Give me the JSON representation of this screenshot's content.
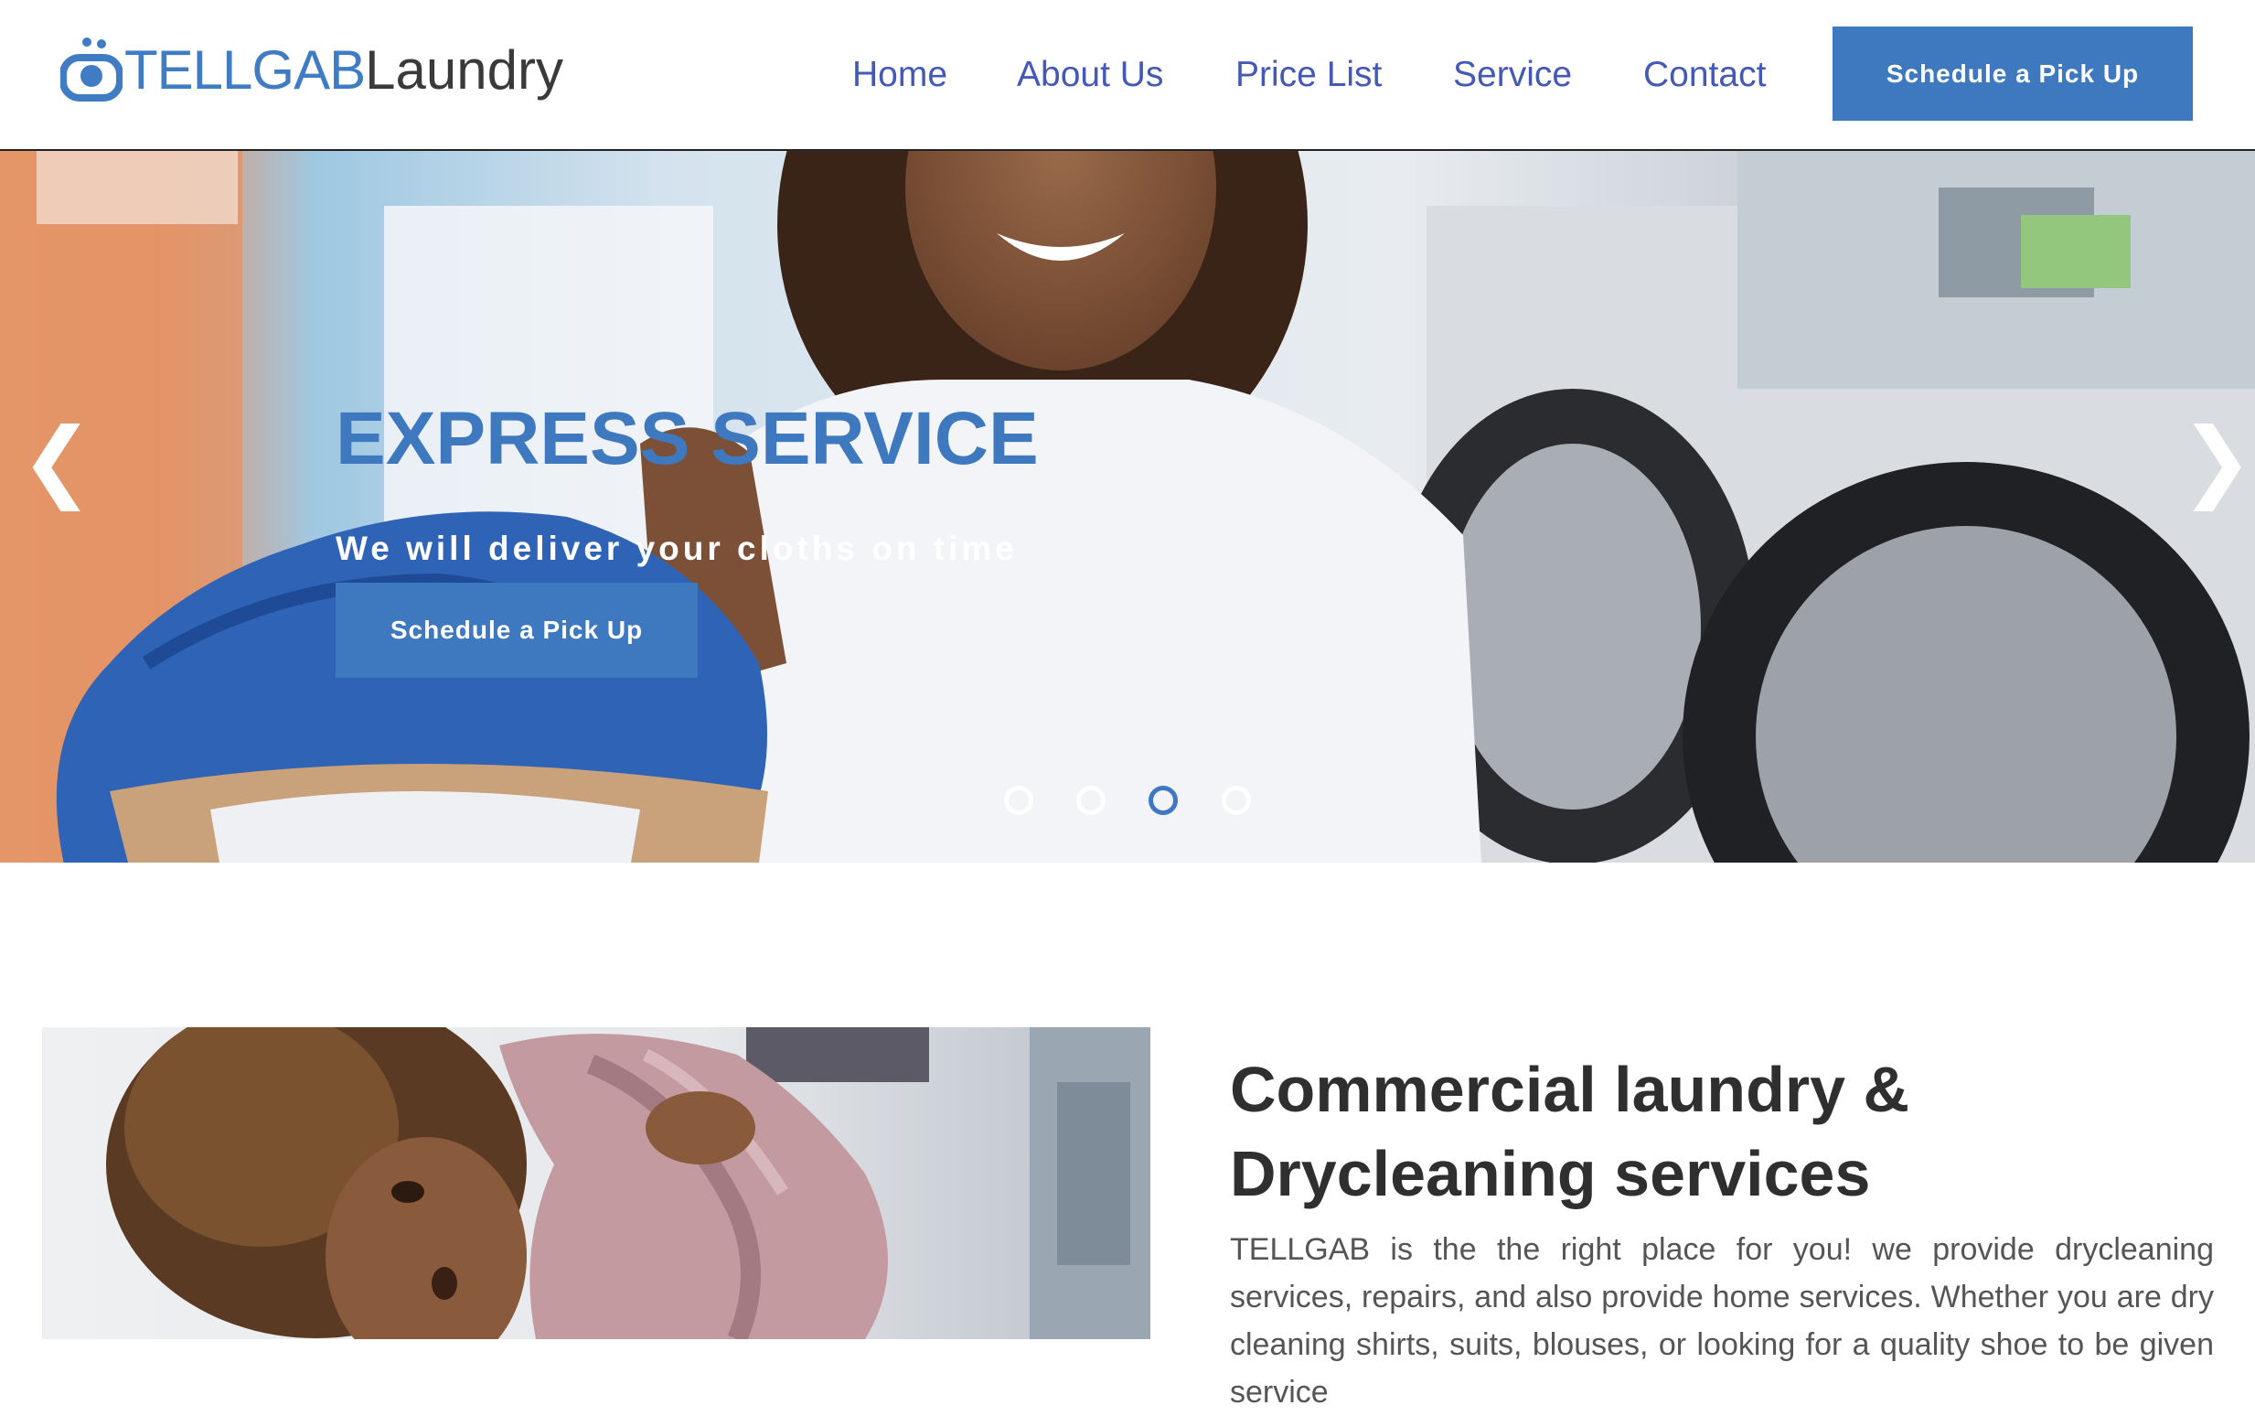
{
  "brand": {
    "name": "TELLGAB",
    "suffix": "Laundry",
    "icon": "washing-machine-logo-icon",
    "colors": {
      "accent": "#3e79c0",
      "nav": "#4458b6",
      "text": "#2f2f2f"
    }
  },
  "nav": {
    "items": [
      {
        "label": "Home"
      },
      {
        "label": "About Us"
      },
      {
        "label": "Price List"
      },
      {
        "label": "Service"
      },
      {
        "label": "Contact"
      }
    ],
    "cta_label": "Schedule a Pick Up"
  },
  "hero": {
    "title": "EXPRESS SERVICE",
    "subtitle": "We will deliver your cloths on time",
    "cta_label": "Schedule a Pick Up",
    "prev_arrow": "❮",
    "next_arrow": "❯",
    "slide_count": 4,
    "active_slide": 3
  },
  "section": {
    "title": "Commercial laundry & Drycleaning services",
    "body": "TELLGAB is the the right place for you! we provide drycleaning services, repairs, and also provide home services. Whether you are dry cleaning shirts, suits, blouses, or looking for a quality shoe to be given service"
  }
}
